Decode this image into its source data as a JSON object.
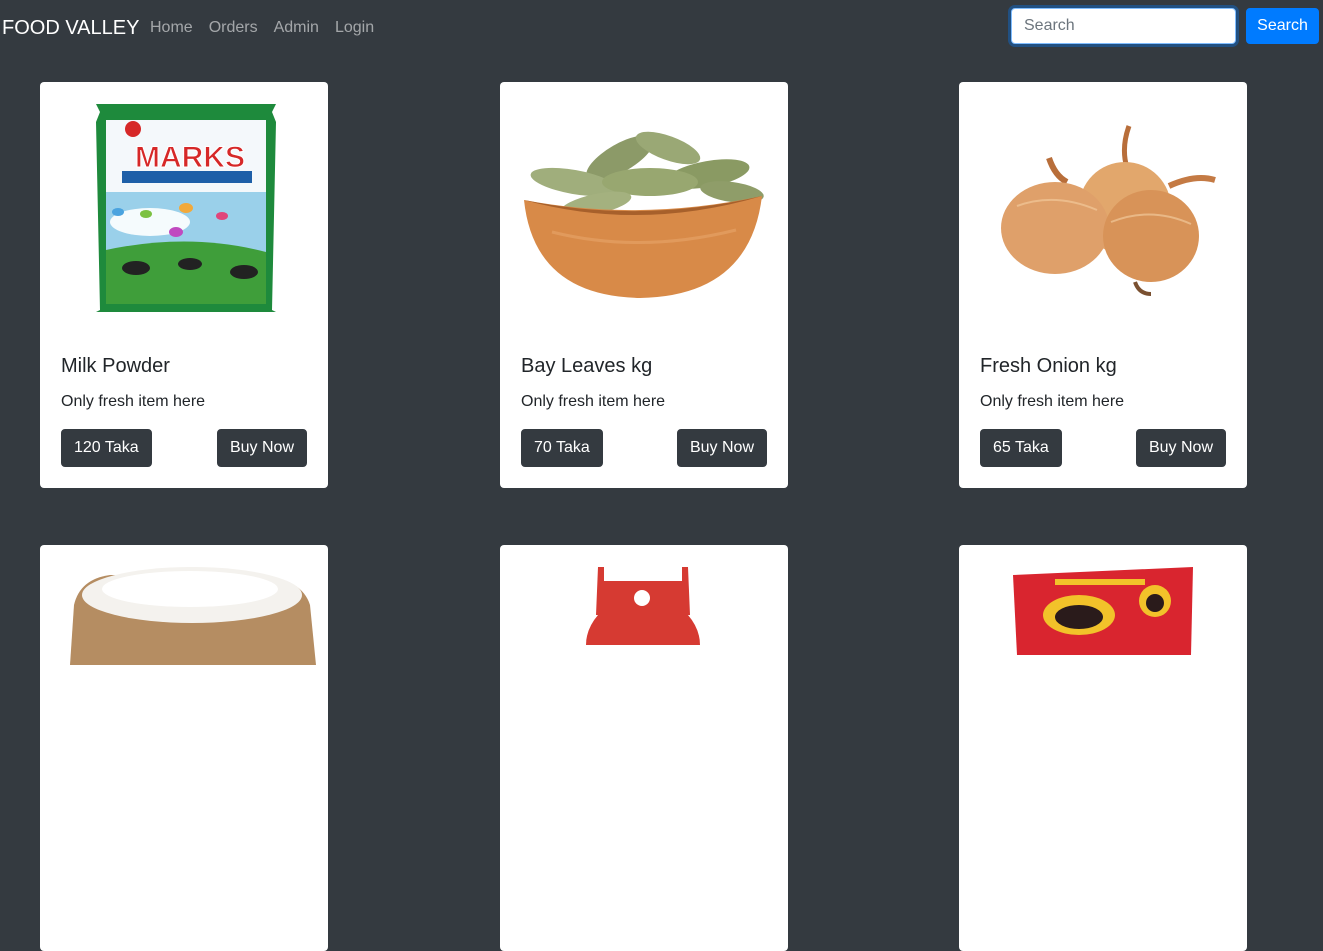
{
  "navbar": {
    "brand": "FOOD VALLEY",
    "links": [
      "Home",
      "Orders",
      "Admin",
      "Login"
    ],
    "search": {
      "placeholder": "Search",
      "value": ""
    },
    "search_button": "Search"
  },
  "products": [
    {
      "title": "Milk Powder",
      "description": "Only fresh item here",
      "price": "120 Taka",
      "buy_label": "Buy Now",
      "image": "marks-milk-powder-pack"
    },
    {
      "title": "Bay Leaves kg",
      "description": "Only fresh item here",
      "price": "70 Taka",
      "buy_label": "Buy Now",
      "image": "bay-leaves-bowl"
    },
    {
      "title": "Fresh Onion kg",
      "description": "Only fresh item here",
      "price": "65 Taka",
      "buy_label": "Buy Now",
      "image": "onions"
    },
    {
      "image": "rice-sack"
    },
    {
      "image": "gas-cylinder"
    },
    {
      "image": "mr-twist-snack-pack"
    }
  ],
  "colors": {
    "background": "#343a40",
    "accent": "#007bff",
    "card": "#ffffff",
    "button_dark": "#343a40"
  }
}
